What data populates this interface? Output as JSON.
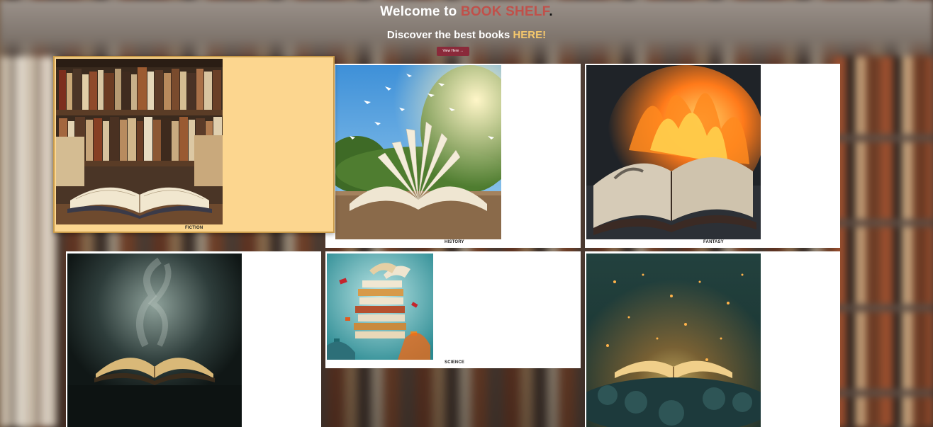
{
  "header": {
    "title_prefix": "Welcome to ",
    "title_brand": "BOOK SHELF",
    "title_suffix": ".",
    "subtitle_prefix": "Discover the best books ",
    "subtitle_highlight": "HERE!",
    "button_label": "View Here →"
  },
  "colors": {
    "brand_accent": "#c0504a",
    "highlight": "#f6c86c",
    "button_bg": "#8a2a3a",
    "active_card_bg": "#fcd68f"
  },
  "categories": [
    {
      "label": "FICTION",
      "image": "open-book-bookshelf-image"
    },
    {
      "label": "HISTORY",
      "image": "open-book-birds-image"
    },
    {
      "label": "FANTASY",
      "image": "burning-book-image"
    },
    {
      "label": "",
      "image": "smoking-book-image"
    },
    {
      "label": "SCIENCE",
      "image": "exploding-books-image"
    },
    {
      "label": "",
      "image": "glowing-book-forest-image"
    }
  ]
}
